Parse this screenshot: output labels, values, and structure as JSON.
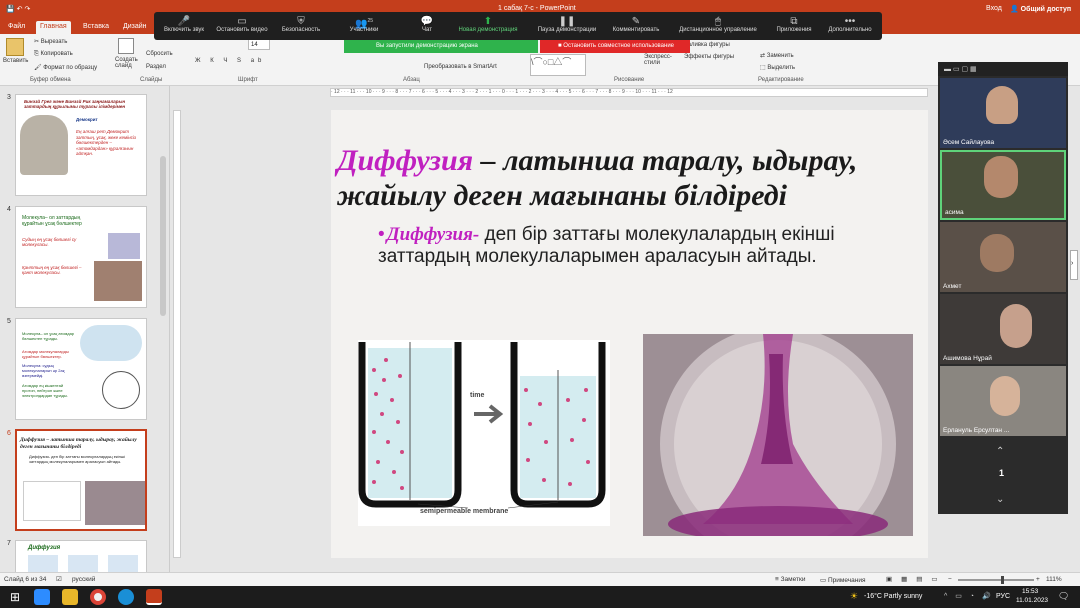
{
  "titlebar": {
    "filename": "1 сабақ 7-с - PowerPoint",
    "signin": "Вход",
    "shared": "Общий доступ"
  },
  "tabs": [
    "Файл",
    "Главная",
    "Вставка",
    "Дизайн"
  ],
  "ribbon": {
    "paste": "Вставить",
    "cut": "Вырезать",
    "copy": "Копировать",
    "format_painter": "Формат по образцу",
    "new_slide": "Создать слайд",
    "reset": "Сбросить",
    "section": "Раздел",
    "replace": "Заменить",
    "select": "Выделить",
    "convert_smartart": "Преобразовать в SmartArt",
    "shape_effects": "Эффекты фигуры",
    "shape_fill": "Заливка фигуры",
    "express_styles": "Экспресс-стили",
    "font_size": "14",
    "groups": {
      "clipboard": "Буфер обмена",
      "slides": "Слайды",
      "font": "Шрифт",
      "paragraph": "Абзац",
      "drawing": "Рисование",
      "editing": "Редактирование"
    }
  },
  "zoom_toolbar": {
    "participant_count": "25",
    "items": [
      {
        "label": "Включить звук",
        "icon": "mic-muted-icon"
      },
      {
        "label": "Остановить видео",
        "icon": "video-icon"
      },
      {
        "label": "Безопасность",
        "icon": "shield-icon"
      },
      {
        "label": "Участники",
        "icon": "participants-icon"
      },
      {
        "label": "Чат",
        "icon": "chat-icon"
      },
      {
        "label": "Новая демонстрация",
        "icon": "share-icon"
      },
      {
        "label": "Пауза демонстрации",
        "icon": "pause-icon"
      },
      {
        "label": "Комментировать",
        "icon": "pen-icon"
      },
      {
        "label": "Дистанционное управление",
        "icon": "remote-icon"
      },
      {
        "label": "Приложения",
        "icon": "apps-icon"
      },
      {
        "label": "Дополнительно",
        "icon": "more-icon"
      }
    ],
    "sharing_notice": "Вы запустили демонстрацию экрана",
    "stop_sharing": "Остановить совместное использование"
  },
  "thumbnails": [
    {
      "num": "3",
      "title": "Бинэзй Грег және Бинэзй Рик заңнамаларын заттардың құрылымы туралы ілімдерімен",
      "sub": "Демокрит",
      "text": "Ең алғаш рет Демокрит заттың, ұсақ, жеке кемінсіз бөлшектерден – «атомдардан» құралғанын айтқан."
    },
    {
      "num": "4",
      "title": "Молекула– ол заттардың құрайтын ұсақ бөлшектер",
      "b1": "Судың ең ұсақ бөлшегі су молекуласы.",
      "b2": "Қанттың ең ұсақ бөлшегі – қант молекуласы."
    },
    {
      "num": "5",
      "b1": "Молекула– ол ұсақ атомдар бөлшектен тұрады.",
      "b2": "Атомдар молекулаларды құрайтын бөлшектер.",
      "b3": "Молекула: судың молекулаларын әр 2ақ өзгермейді.",
      "b4": "Атомдар ең кішкентай протон, нейтрон және электрондардан тұрады."
    },
    {
      "num": "6",
      "title": "Диффузия – латынша таралу, ыдырау, жайылу деген мағынаны білдіреді",
      "b1": "Диффузия- деп бір заттағы молекулалардың екінші заттардың молекулаларымен араласуын айтады."
    },
    {
      "num": "7",
      "title": "Диффузия"
    }
  ],
  "slide": {
    "title_term": "Диффузия",
    "title_rest": " – латынша таралу, ыдырау, жайылу деген мағынаны білдіреді",
    "bullet_term": "Диффузия-",
    "bullet_rest": " деп бір заттағы молекулалардың екінші заттардың молекулаларымен араласуын айтады.",
    "diagram_time": "time",
    "diagram_caption": "semipermeable membrane"
  },
  "ruler_marks": "· 12 · · · 11 · · · 10 · · · 9 · · · 8 · · · 7 · · · 6 · · · 5 · · · 4 · · · 3 · · · 2 · · · 1 · · · 0 · · · 1 · · · 2 · · · 3 · · · 4 · · · 5 · · · 6 · · · 7 · · · 8 · · · 9 · · · 10 · · · 11 · · · 12",
  "participants": [
    {
      "name": "Әсем Сайлауова"
    },
    {
      "name": "асима"
    },
    {
      "name": "Ахмет"
    },
    {
      "name": "Ашимова Нұрай"
    },
    {
      "name": "Ерлануль Ерсултан ..."
    }
  ],
  "video_page": "1",
  "status": {
    "slide_of": "Слайд 6 из 34",
    "language": "русский",
    "notes": "Заметки",
    "comments": "Примечания",
    "zoom": "111%"
  },
  "taskbar": {
    "weather": "-16°C Partly sunny",
    "lang": "РУС",
    "time": "15:53",
    "date": "11.01.2023"
  },
  "colors": {
    "accent": "#c43e1c",
    "magenta": "#c020c0",
    "share_green": "#2fb34c",
    "share_red": "#e02828"
  }
}
